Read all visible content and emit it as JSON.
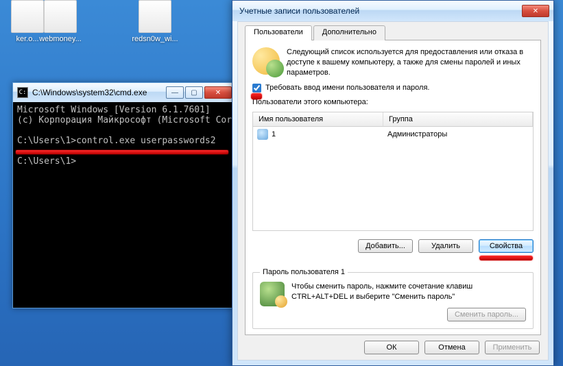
{
  "desktop": {
    "icons": [
      {
        "label": "ker.o..."
      },
      {
        "label": "webmoney..."
      },
      {
        "label": "redsn0w_wi..."
      }
    ]
  },
  "cmd": {
    "title": "C:\\Windows\\system32\\cmd.exe",
    "lines": {
      "l1": "Microsoft Windows [Version 6.1.7601]",
      "l2": "(c) Корпорация Майкрософт (Microsoft Corp",
      "l3": "C:\\Users\\1>control.exe userpasswords2",
      "l4": "C:\\Users\\1>"
    }
  },
  "dialog": {
    "title": "Учетные записи пользователей",
    "tabs": {
      "users": "Пользователи",
      "advanced": "Дополнительно"
    },
    "intro": "Следующий список используется для предоставления или отказа в доступе к вашему компьютеру, а также для смены паролей и иных параметров.",
    "require_checkbox": "Требовать ввод имени пользователя и пароля.",
    "list_label": "Пользователи этого компьютера:",
    "columns": {
      "user": "Имя пользователя",
      "group": "Группа"
    },
    "rows": [
      {
        "user": "1",
        "group": "Администраторы"
      }
    ],
    "buttons": {
      "add": "Добавить...",
      "remove": "Удалить",
      "props": "Свойства"
    },
    "pwd_group": {
      "legend": "Пароль пользователя 1",
      "text": "Чтобы сменить пароль, нажмите сочетание клавиш CTRL+ALT+DEL и выберите \"Сменить пароль\"",
      "change": "Сменить пароль..."
    },
    "footer": {
      "ok": "ОК",
      "cancel": "Отмена",
      "apply": "Применить"
    }
  }
}
